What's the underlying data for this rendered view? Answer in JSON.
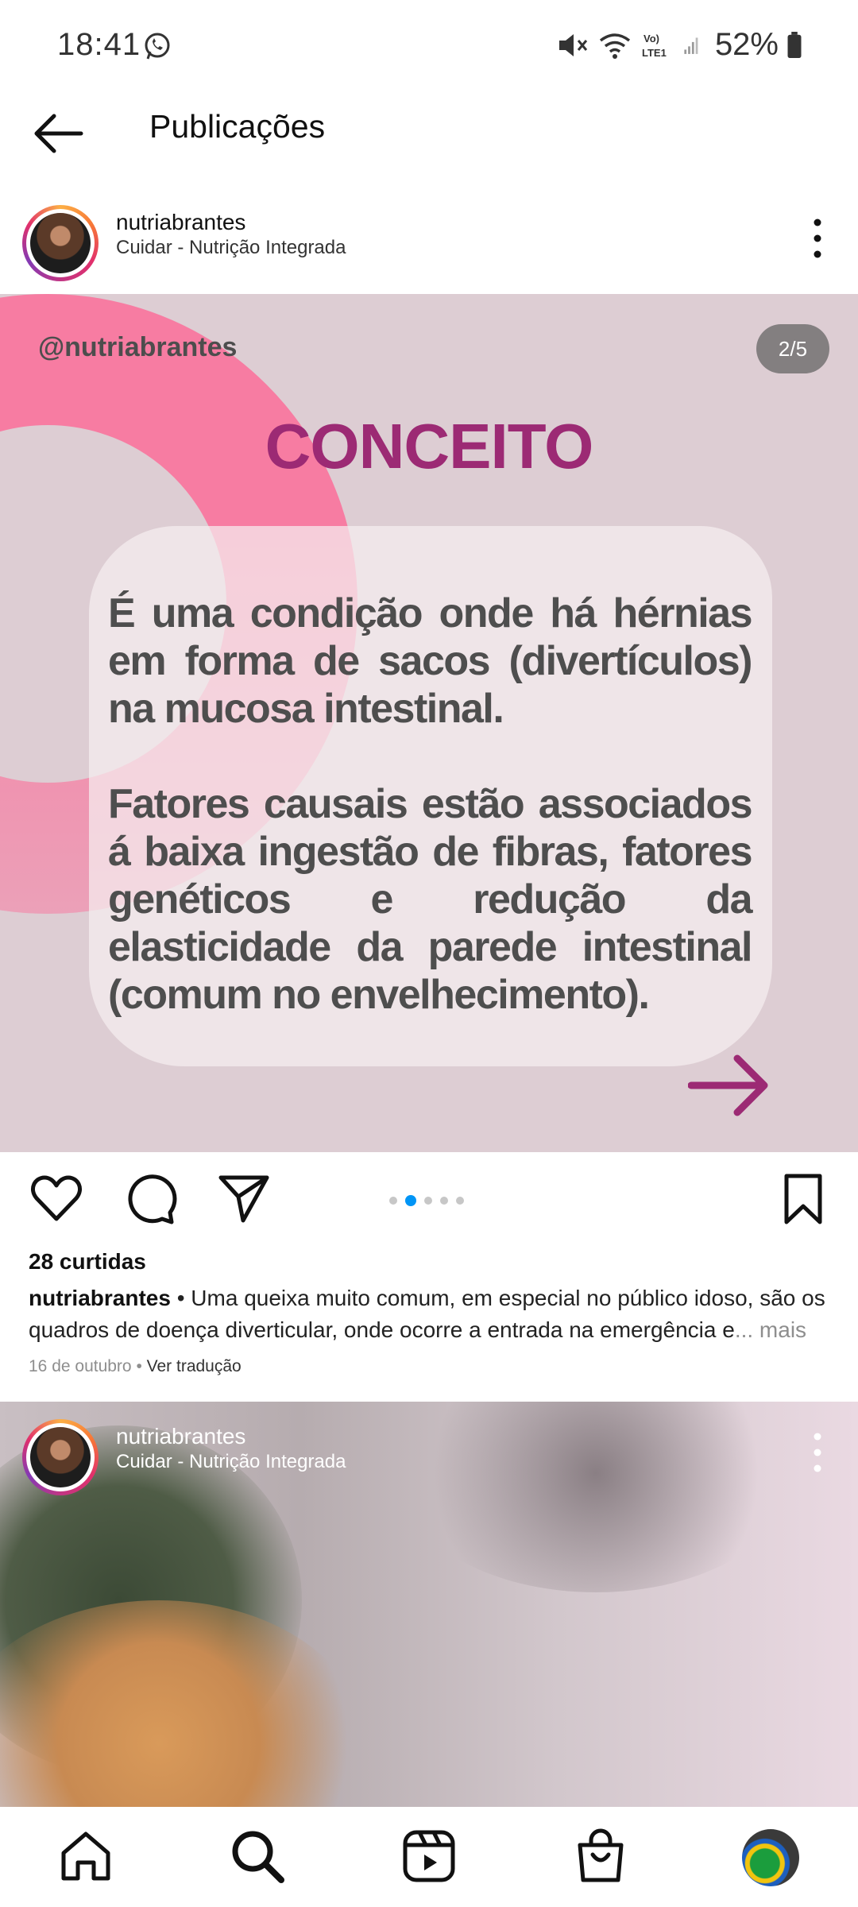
{
  "status_bar": {
    "time": "18:41",
    "battery": "52%",
    "network": "LTE1"
  },
  "header": {
    "title": "Publicações"
  },
  "post": {
    "username": "nutriabrantes",
    "subtitle": "Cuidar - Nutrição Integrada",
    "slide": {
      "handle": "@nutriabrantes",
      "counter": "2/5",
      "title": "CONCEITO",
      "paragraph1": "É uma condição onde há hérnias em forma de sacos (divertículos) na mucosa intestinal.",
      "paragraph2": "Fatores causais estão associados á baixa ingestão de fibras, fatores genéticos e redução da elasticidade da parede intestinal (comum no envelhecimento).",
      "total_slides": 5,
      "active_slide": 2
    },
    "likes": "28 curtidas",
    "caption_user": "nutriabrantes",
    "caption_text": " • Uma queixa muito comum, em especial no público idoso, são os quadros de doença diverticular, onde ocorre a entrada na emergência e",
    "caption_more": "... mais",
    "date": "16 de outubro",
    "translate": "Ver tradução"
  },
  "post2": {
    "username": "nutriabrantes",
    "subtitle": "Cuidar - Nutrição Integrada"
  },
  "colors": {
    "slide_bg": "#ddcdd3",
    "accent_pink": "#f77ca2",
    "title_magenta": "#9c2a74",
    "active_dot": "#0095f6"
  },
  "icons": {
    "nav": [
      "home-icon",
      "search-icon",
      "reels-icon",
      "shop-icon",
      "profile-avatar"
    ],
    "actions": [
      "heart-icon",
      "comment-icon",
      "share-icon",
      "bookmark-icon"
    ]
  }
}
